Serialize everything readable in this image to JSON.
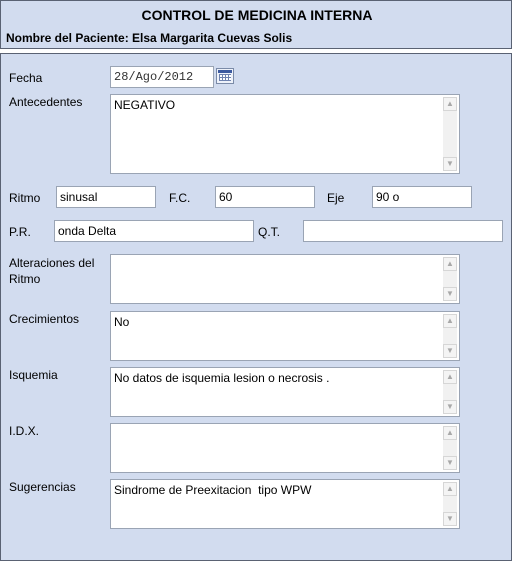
{
  "header": {
    "title": "CONTROL DE MEDICINA INTERNA",
    "patient_label": "Nombre del Paciente:",
    "patient_name": "Elsa Margarita Cuevas Solis"
  },
  "form": {
    "fecha": {
      "label": "Fecha",
      "value": "28/Ago/2012"
    },
    "antecedentes": {
      "label": "Antecedentes",
      "value": "NEGATIVO"
    },
    "ritmo": {
      "label": "Ritmo",
      "value": "sinusal"
    },
    "fc": {
      "label": "F.C.",
      "value": "60"
    },
    "eje": {
      "label": "Eje",
      "value": "90 o"
    },
    "pr": {
      "label": "P.R.",
      "value": "onda Delta"
    },
    "qt": {
      "label": "Q.T.",
      "value": ""
    },
    "alteraciones": {
      "label_line1": "Alteraciones del",
      "label_line2": "Ritmo",
      "value": ""
    },
    "crecimientos": {
      "label": "Crecimientos",
      "value": "No"
    },
    "isquemia": {
      "label": "Isquemia",
      "value": "No datos de isquemia lesion o necrosis ."
    },
    "idx": {
      "label": "I.D.X.",
      "value": ""
    },
    "sugerencias": {
      "label": "Sugerencias",
      "value": "Sindrome de Preexitacion  tipo WPW"
    }
  },
  "icons": {
    "calendar": "calendar-icon",
    "scroll_up": "scroll-up-icon",
    "scroll_down": "scroll-down-icon"
  }
}
